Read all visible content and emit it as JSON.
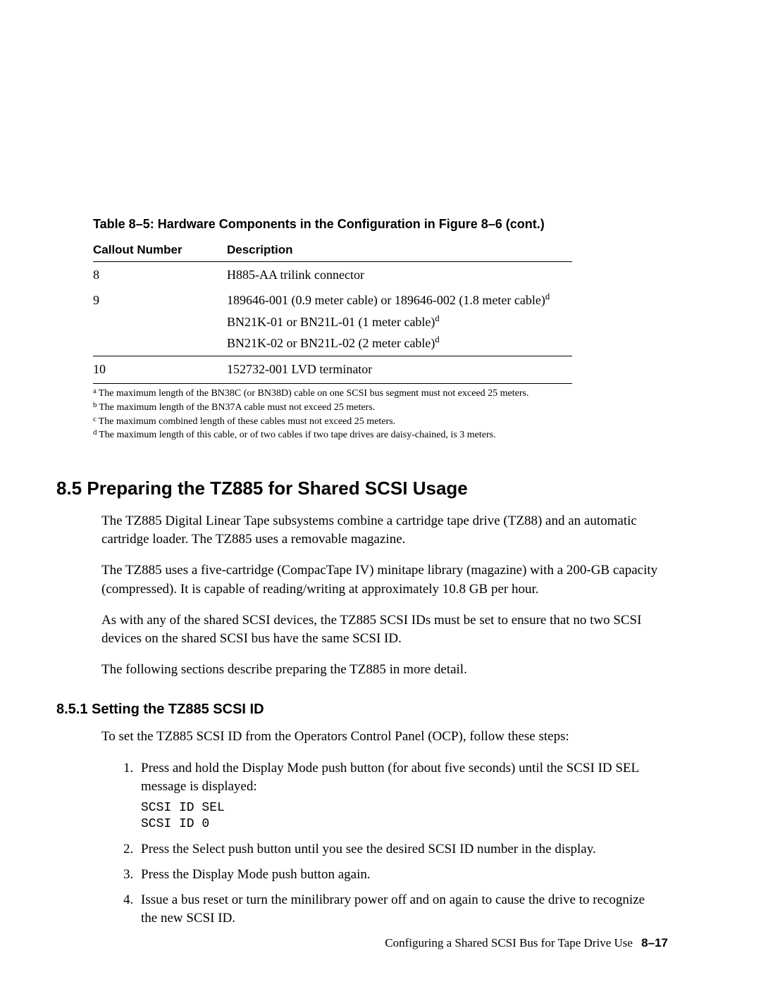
{
  "table": {
    "caption": "Table 8–5: Hardware Components in the Configuration in Figure 8–6 (cont.)",
    "header": {
      "col1": "Callout Number",
      "col2": "Description"
    },
    "rows": {
      "r0": {
        "callout": "8",
        "desc": "H885-AA trilink connector"
      },
      "r1": {
        "callout": "9",
        "desc_part_a": "189646-001 (0.9 meter cable) or 189646-002 (1.8 meter cable)",
        "desc_part_a_sup": "d",
        "desc_part_b": "BN21K-01 or BN21L-01 (1 meter cable)",
        "desc_part_b_sup": "d",
        "desc_part_c": "BN21K-02 or BN21L-02 (2 meter cable)",
        "desc_part_c_sup": "d"
      },
      "r2": {
        "callout": "10",
        "desc": "152732-001 LVD terminator"
      }
    },
    "footnotes": {
      "a": "The maximum length of the BN38C (or BN38D) cable on one SCSI bus segment must not exceed 25 meters.",
      "b": "The maximum length of the BN37A cable must not exceed 25 meters.",
      "c": "The maximum combined length of these cables must not exceed 25 meters.",
      "d": "The maximum length of this cable, or of two cables if two tape drives are daisy-chained, is 3 meters."
    }
  },
  "section85": {
    "heading": "8.5 Preparing the TZ885 for Shared SCSI Usage",
    "p1": "The TZ885 Digital Linear Tape subsystems combine a cartridge tape drive (TZ88) and an automatic cartridge loader. The TZ885 uses a removable magazine.",
    "p2": "The TZ885 uses a five-cartridge (CompacTape IV) minitape library (magazine) with a 200-GB capacity (compressed). It is capable of reading/writing at approximately 10.8 GB per hour.",
    "p3": "As with any of the shared SCSI devices, the TZ885 SCSI IDs must be set to ensure that no two SCSI devices on the shared SCSI bus have the same SCSI ID.",
    "p4": "The following sections describe preparing the TZ885 in more detail."
  },
  "section851": {
    "heading": "8.5.1 Setting the TZ885 SCSI ID",
    "intro": "To set the TZ885 SCSI ID from the Operators Control Panel (OCP), follow these steps:",
    "steps": {
      "s1": "Press and hold the Display Mode push button (for about five seconds) until the SCSI ID SEL message is displayed:",
      "code": "SCSI ID SEL\nSCSI ID 0",
      "s2": "Press the Select push button until you see the desired SCSI ID number in the display.",
      "s3": "Press the Display Mode push button again.",
      "s4": "Issue a bus reset or turn the minilibrary power off and on again to cause the drive to recognize the new SCSI ID."
    }
  },
  "footer": {
    "chapter": "Configuring a Shared SCSI Bus for Tape Drive Use",
    "page": "8–17"
  }
}
